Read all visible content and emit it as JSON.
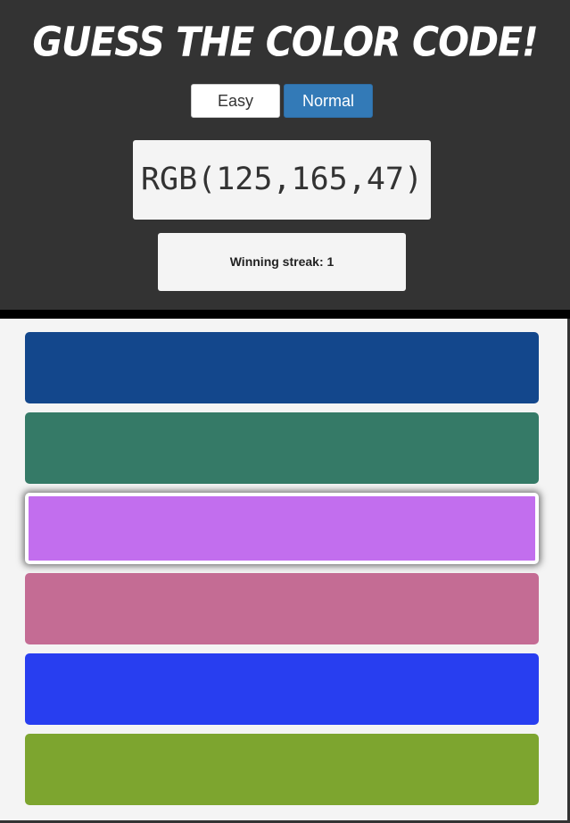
{
  "title": "Guess the Color Code!",
  "modes": {
    "easy_label": "Easy",
    "normal_label": "Normal",
    "active": "Normal"
  },
  "target": {
    "code": "RGB(125,165,47)"
  },
  "streak": {
    "text": "Winning streak: 1"
  },
  "colors": {
    "header_bg": "#333333",
    "board_bg": "#f4f4f4",
    "active_button": "#337ab7"
  },
  "tiles": [
    {
      "color": "#13478c",
      "selected": false
    },
    {
      "color": "#357a67",
      "selected": false
    },
    {
      "color": "#c26eee",
      "selected": true
    },
    {
      "color": "#c46c94",
      "selected": false
    },
    {
      "color": "#283ef0",
      "selected": false
    },
    {
      "color": "#7da52f",
      "selected": false
    }
  ]
}
